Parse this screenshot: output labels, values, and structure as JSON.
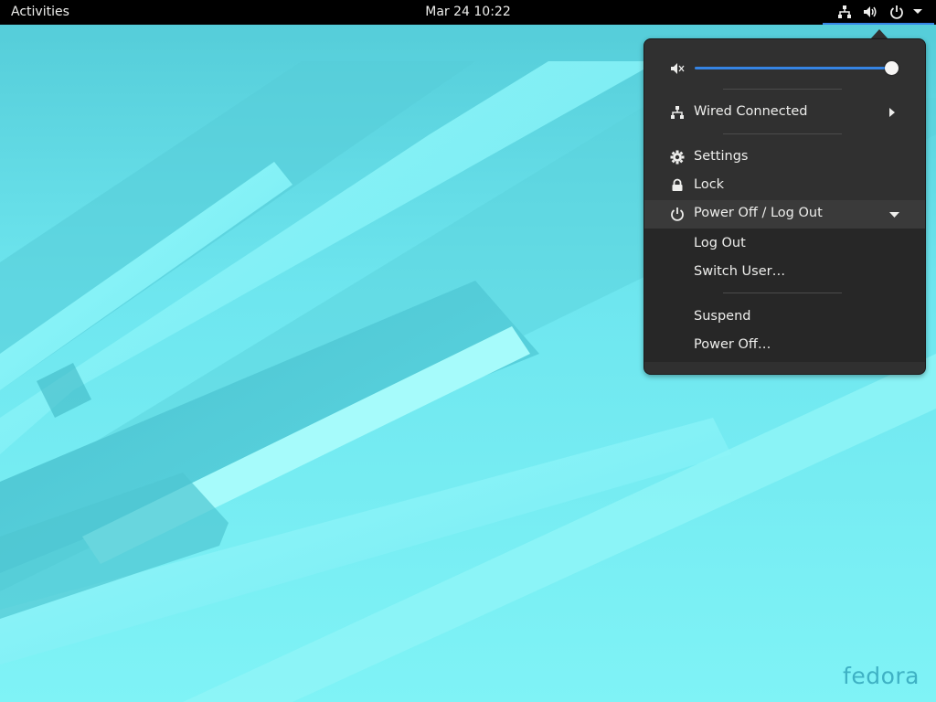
{
  "topbar": {
    "activities_label": "Activities",
    "clock_label": "Mar 24  10:22",
    "icons": [
      "network-wired-icon",
      "volume-icon",
      "power-icon",
      "dropdown-arrow-icon"
    ]
  },
  "system_menu": {
    "volume": {
      "icon": "volume-muted-icon",
      "level": 1.0
    },
    "network": {
      "label": "Wired Connected",
      "icon": "network-wired-icon"
    },
    "settings": {
      "label": "Settings",
      "icon": "gear-icon"
    },
    "lock": {
      "label": "Lock",
      "icon": "lock-icon"
    },
    "power": {
      "label": "Power Off / Log Out",
      "icon": "power-icon",
      "submenu": {
        "log_out": "Log Out",
        "switch_user": "Switch User…",
        "suspend": "Suspend",
        "power_off": "Power Off…"
      }
    }
  },
  "desktop": {
    "watermark": "fedora"
  },
  "colors": {
    "accent": "#3584e4",
    "menu_bg": "#303030",
    "topbar_bg": "#000000",
    "desktop_bg": "#6fe3ea"
  }
}
